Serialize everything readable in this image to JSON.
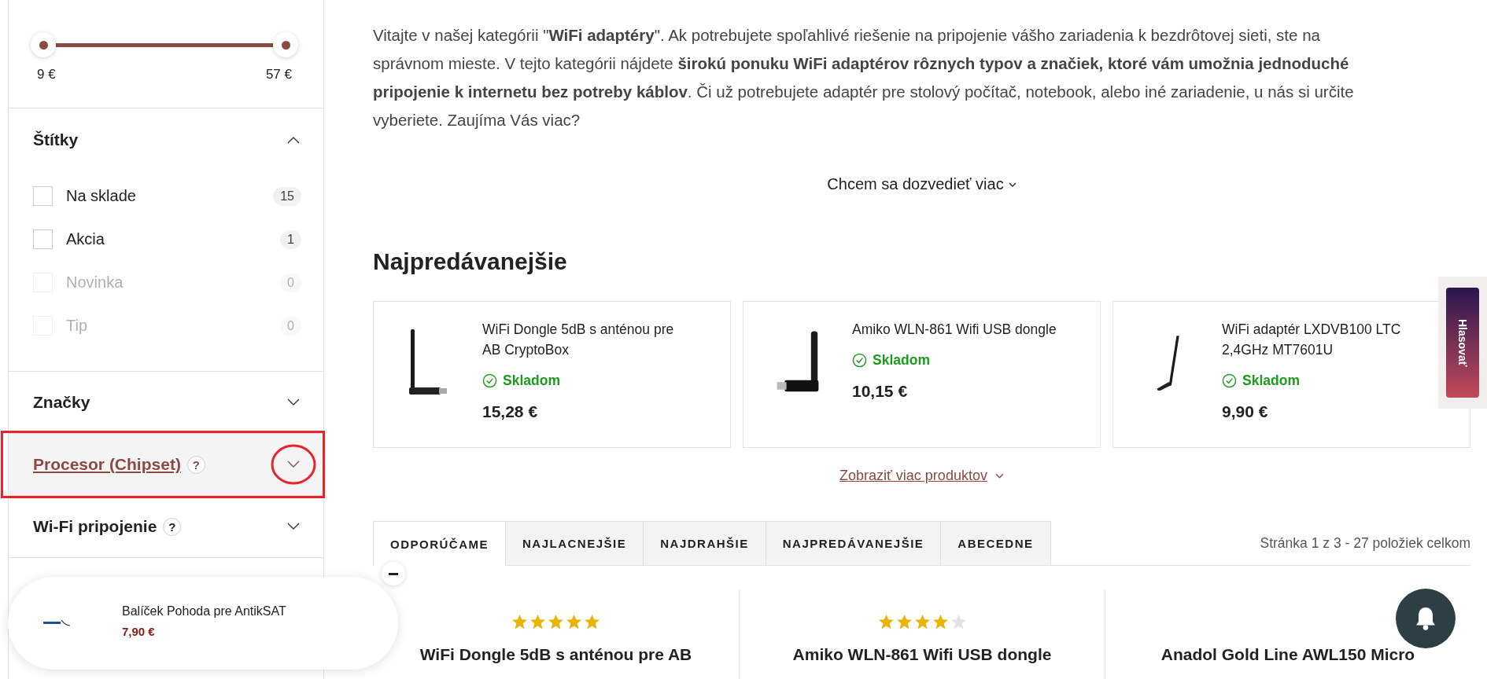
{
  "price_filter": {
    "min_label": "9 €",
    "max_label": "57 €"
  },
  "filters": [
    {
      "title": "Štítky",
      "expanded": true,
      "highlighted": false,
      "annotated": false,
      "options": [
        {
          "label": "Na sklade",
          "count": "15",
          "checked": false,
          "disabled": false
        },
        {
          "label": "Akcia",
          "count": "1",
          "checked": false,
          "disabled": false
        },
        {
          "label": "Novinka",
          "count": "0",
          "checked": false,
          "disabled": true
        },
        {
          "label": "Tip",
          "count": "0",
          "checked": false,
          "disabled": true
        }
      ]
    },
    {
      "title": "Značky",
      "expanded": false,
      "highlighted": false,
      "annotated": false
    },
    {
      "title": "Procesor (Chipset)",
      "help": "?",
      "expanded": false,
      "highlighted": true,
      "annotated": true
    },
    {
      "title": "Wi-Fi pripojenie",
      "help": "?",
      "expanded": false,
      "highlighted": false,
      "annotated": false
    }
  ],
  "intro": "Vitajte v našej kategórii \"**WiFi adaptéry**\". Ak potrebujete spoľahlivé riešenie na pripojenie vášho zariadenia k bezdrôtovej sieti, ste na správnom mieste. V tejto kategórii nájdete **širokú ponuku WiFi adaptérov rôznych typov a značiek, ktoré vám umožnia jednoduché pripojenie k internetu bez potreby káblov**. Či už potrebujete adaptér pre stolový počítač, notebook, alebo iné zariadenie, u nás si určite vyberiete. Zaujíma Vás viac?",
  "more_link": "Chcem sa dozvedieť viac",
  "bestsellers": {
    "title": "Najpredávanejšie",
    "show_more": "Zobraziť viac produktov",
    "products": [
      {
        "name": "WiFi Dongle 5dB s anténou pre AB CryptoBox",
        "availability": "Skladom",
        "price": "15,28 €"
      },
      {
        "name": "Amiko WLN-861 Wifi USB dongle",
        "availability": "Skladom",
        "price": "10,15 €"
      },
      {
        "name": "WiFi adaptér LXDVB100 LTC 2,4GHz MT7601U",
        "availability": "Skladom",
        "price": "9,90 €"
      }
    ]
  },
  "sort_tabs": [
    {
      "label": "ODPORÚČAME",
      "selected": true
    },
    {
      "label": "NAJLACNEJŠIE",
      "selected": false
    },
    {
      "label": "NAJDRAHŠIE",
      "selected": false
    },
    {
      "label": "NAJPREDÁVANEJŠIE",
      "selected": false
    },
    {
      "label": "ABECEDNE",
      "selected": false
    }
  ],
  "pagination_info": "Stránka 1 z 3 - 27 položiek celkom",
  "products": [
    {
      "stars": 5,
      "name": "WiFi Dongle 5dB s anténou pre AB"
    },
    {
      "stars": 4,
      "name": "Amiko WLN-861 Wifi USB dongle"
    },
    {
      "name": "Anadol Gold Line AWL150 Micro"
    }
  ],
  "vote_tab": "Hlasovať",
  "popup": {
    "name": "Balíček Pohoda pre AntikSAT",
    "price": "7,90 €"
  }
}
